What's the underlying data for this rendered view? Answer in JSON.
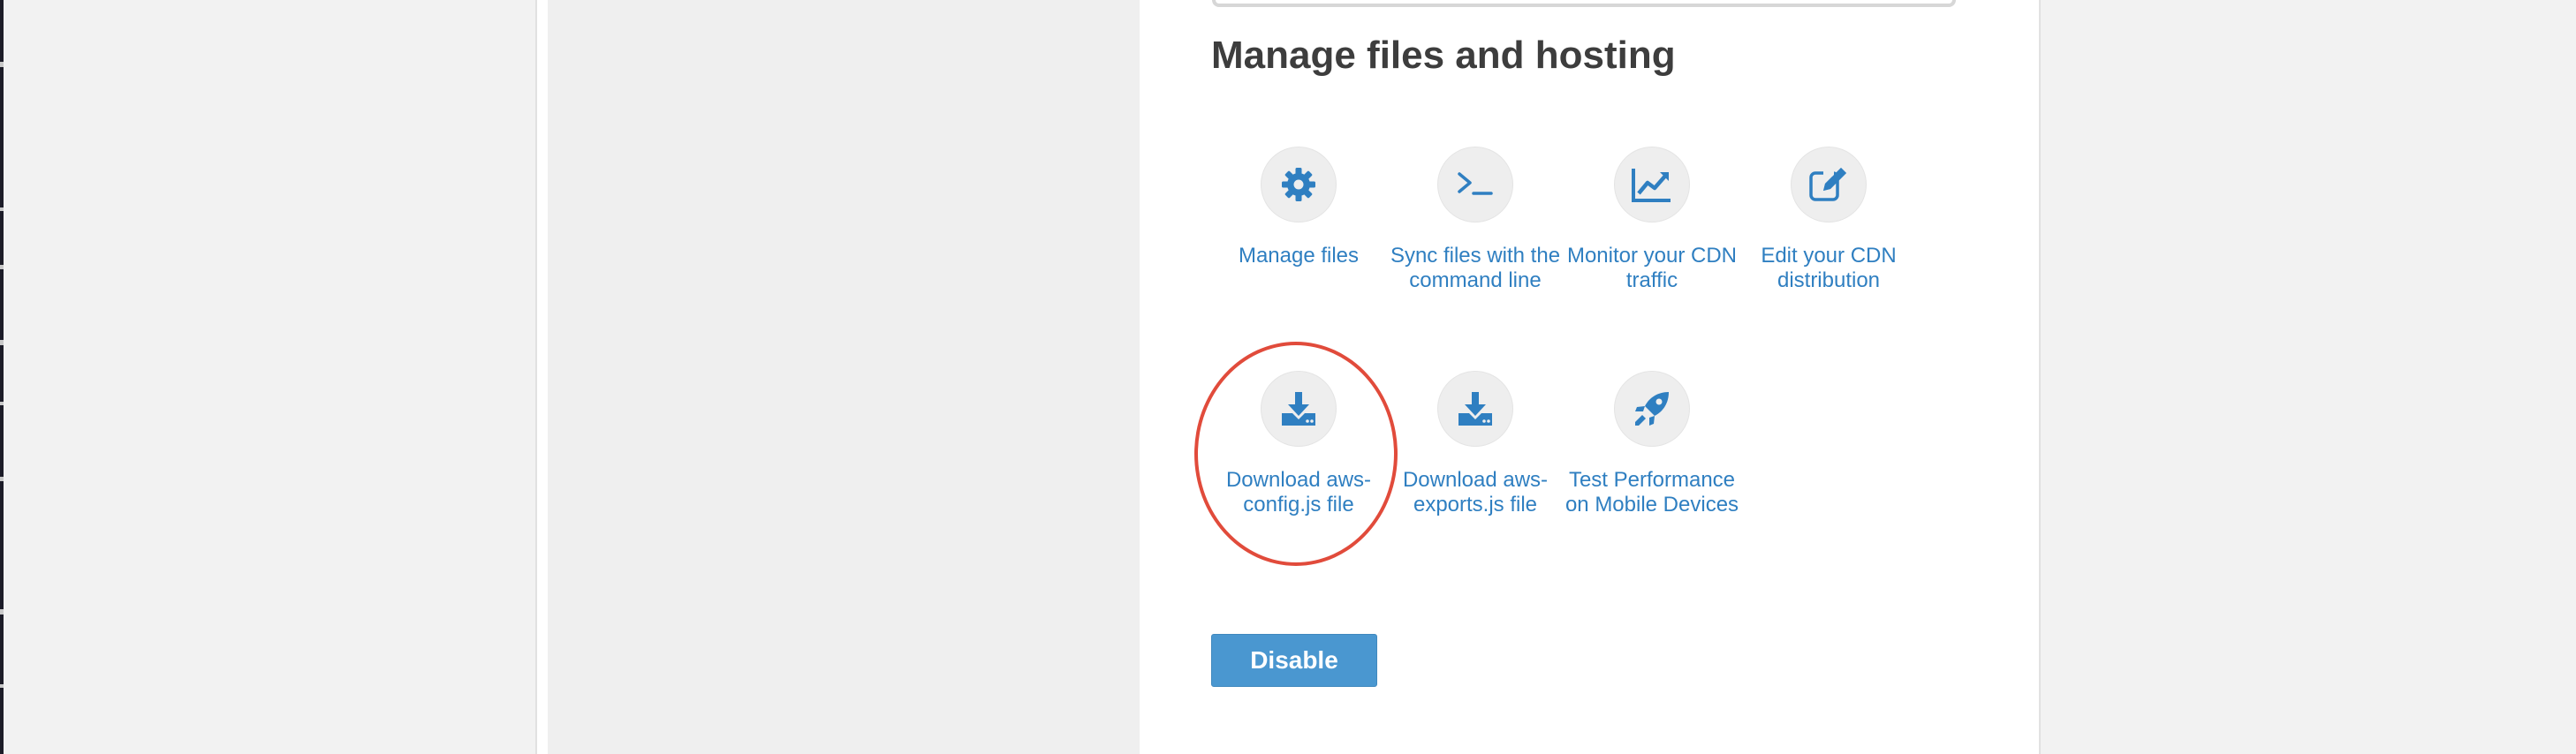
{
  "section": {
    "title": "Manage files and hosting"
  },
  "actions": [
    {
      "label": "Manage files",
      "icon": "gear-icon"
    },
    {
      "label": "Sync files with the command line",
      "icon": "terminal-prompt-icon"
    },
    {
      "label": "Monitor your CDN traffic",
      "icon": "line-chart-icon"
    },
    {
      "label": "Edit your CDN distribution",
      "icon": "edit-pencil-icon"
    },
    {
      "label": "Download aws-config.js file",
      "icon": "download-tray-icon"
    },
    {
      "label": "Download aws-exports.js file",
      "icon": "download-tray-icon"
    },
    {
      "label": "Test Performance on Mobile Devices",
      "icon": "rocket-icon"
    }
  ],
  "annotation": {
    "highlighted_action": "Download aws-config.js file",
    "ring_color": "#e14b3b"
  },
  "buttons": {
    "disable_label": "Disable"
  },
  "colors": {
    "link": "#2f7fc1",
    "button_bg": "#4a97d0",
    "icon_blue": "#2f7fc1"
  }
}
